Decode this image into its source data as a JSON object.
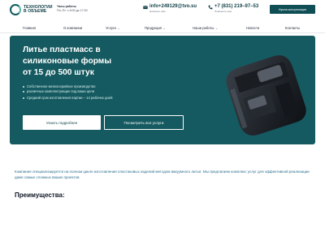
{
  "header": {
    "logo_line1": "ТЕХНОЛОГИИ",
    "logo_line2": "В ОБЪЕМЕ",
    "hours_title": "Часы работы",
    "hours_value": "Пн–Пт: с 8:00 до 17:00",
    "email": "info+249129@tvo.su",
    "email_caption": "Написать нам",
    "phone": "+7 (831) 219–97–53",
    "phone_caption": "Позвонить нам",
    "consult_label": "Нужна консультация"
  },
  "nav": {
    "items": [
      {
        "label": "Главная",
        "dropdown": false
      },
      {
        "label": "О компании",
        "dropdown": false
      },
      {
        "label": "Услуги",
        "dropdown": true
      },
      {
        "label": "Продукция",
        "dropdown": true
      },
      {
        "label": "Наши работы",
        "dropdown": true
      },
      {
        "label": "Новости",
        "dropdown": false
      },
      {
        "label": "Контакты",
        "dropdown": false
      }
    ]
  },
  "hero": {
    "title_line1": "Литье пластмасс в",
    "title_line2": "силиконовые формы",
    "title_line3": "от 15 до 500 штук",
    "bullets": [
      "Собственное мелкосерийное производство",
      "различных комплектующих под ваши цели",
      "Средний срок изготовления партии – 14 рабочих дней"
    ],
    "btn_more": "Узнать подробнее",
    "btn_services": "Посмотреть все услуги",
    "bg_color": "#155a60"
  },
  "intro": {
    "text": "Компания специализируется на полном цикле изготовления пластиковых изделий методом вакуумного литья. Мы предлагаем комплекс услуг для эффективной реализации даже самых сложных ваших проектов."
  },
  "advantages": {
    "title": "Преимущества:"
  }
}
